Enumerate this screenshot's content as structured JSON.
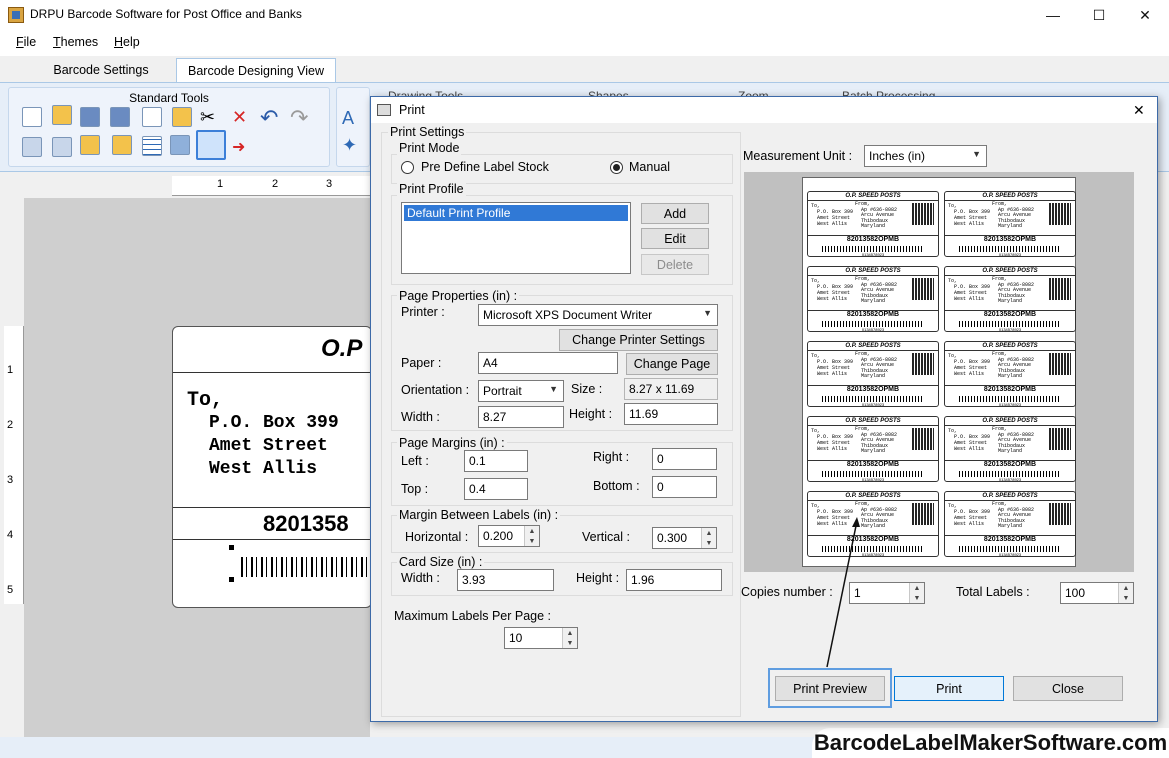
{
  "app": {
    "title": "DRPU Barcode Software for Post Office and Banks",
    "window_controls": {
      "minimize": "—",
      "maximize": "☐",
      "close": "✕"
    }
  },
  "menu": [
    "File",
    "Themes",
    "Help"
  ],
  "tabs": [
    "Barcode Settings",
    "Barcode Designing View"
  ],
  "ribbon": {
    "standard_tools_label": "Standard Tools",
    "other_groups": [
      "Drawing Tools",
      "Shapes",
      "Zoom",
      "Batch Processing"
    ]
  },
  "ruler": {
    "h_ticks": [
      "1",
      "2",
      "3"
    ],
    "v_ticks": [
      "1",
      "2",
      "3",
      "4",
      "5"
    ]
  },
  "canvas_label": {
    "header": "O.P",
    "to": "To,",
    "lines": [
      "P.O. Box 399",
      "Amet Street",
      "West Allis"
    ],
    "number": "8201358"
  },
  "dialog": {
    "title": "Print",
    "close": "✕",
    "print_settings": "Print Settings",
    "print_mode": {
      "legend": "Print Mode",
      "options": [
        "Pre Define Label Stock",
        "Manual"
      ],
      "selected": "Manual"
    },
    "print_profile": {
      "legend": "Print Profile",
      "items": [
        "Default Print Profile"
      ],
      "add": "Add",
      "edit": "Edit",
      "delete": "Delete"
    },
    "page_properties": {
      "legend": "Page Properties (in) :",
      "printer_label": "Printer :",
      "printer": "Microsoft XPS Document Writer",
      "change_printer": "Change Printer Settings",
      "paper_label": "Paper :",
      "paper": "A4",
      "change_page": "Change Page",
      "orientation_label": "Orientation :",
      "orientation": "Portrait",
      "size_label": "Size :",
      "size": "8.27 x 11.69",
      "width_label": "Width :",
      "width": "8.27",
      "height_label": "Height :",
      "height": "11.69"
    },
    "page_margins": {
      "legend": "Page Margins (in) :",
      "left_label": "Left :",
      "left": "0.1",
      "right_label": "Right :",
      "right": "0",
      "top_label": "Top :",
      "top": "0.4",
      "bottom_label": "Bottom :",
      "bottom": "0"
    },
    "margin_between": {
      "legend": "Margin Between Labels (in) :",
      "horizontal_label": "Horizontal :",
      "horizontal": "0.200",
      "vertical_label": "Vertical :",
      "vertical": "0.300"
    },
    "card_size": {
      "legend": "Card Size (in) :",
      "width_label": "Width :",
      "width": "3.93",
      "height_label": "Height :",
      "height": "1.96"
    },
    "max_labels_label": "Maximum Labels Per Page :",
    "max_labels": "10",
    "measurement_unit_label": "Measurement Unit :",
    "measurement_unit": "Inches (in)",
    "copies_label": "Copies number :",
    "copies": "1",
    "total_labels_label": "Total Labels :",
    "total_labels": "100",
    "buttons": {
      "preview": "Print Preview",
      "print": "Print",
      "close": "Close"
    },
    "mini_label": {
      "header": "O.P. SPEED POSTS",
      "to": "To,",
      "to_lines": "  P.O. Box 399\n  Amet Street\n  West Allis",
      "from": "From,",
      "from_lines": "  Ap #636-8082\n  Arcu Avenue\n  Thibodaux\n  Maryland",
      "number": "82013582OPMB",
      "barcode_text": "0134578923"
    }
  },
  "watermark": "BarcodeLabelMakerSoftware.com"
}
